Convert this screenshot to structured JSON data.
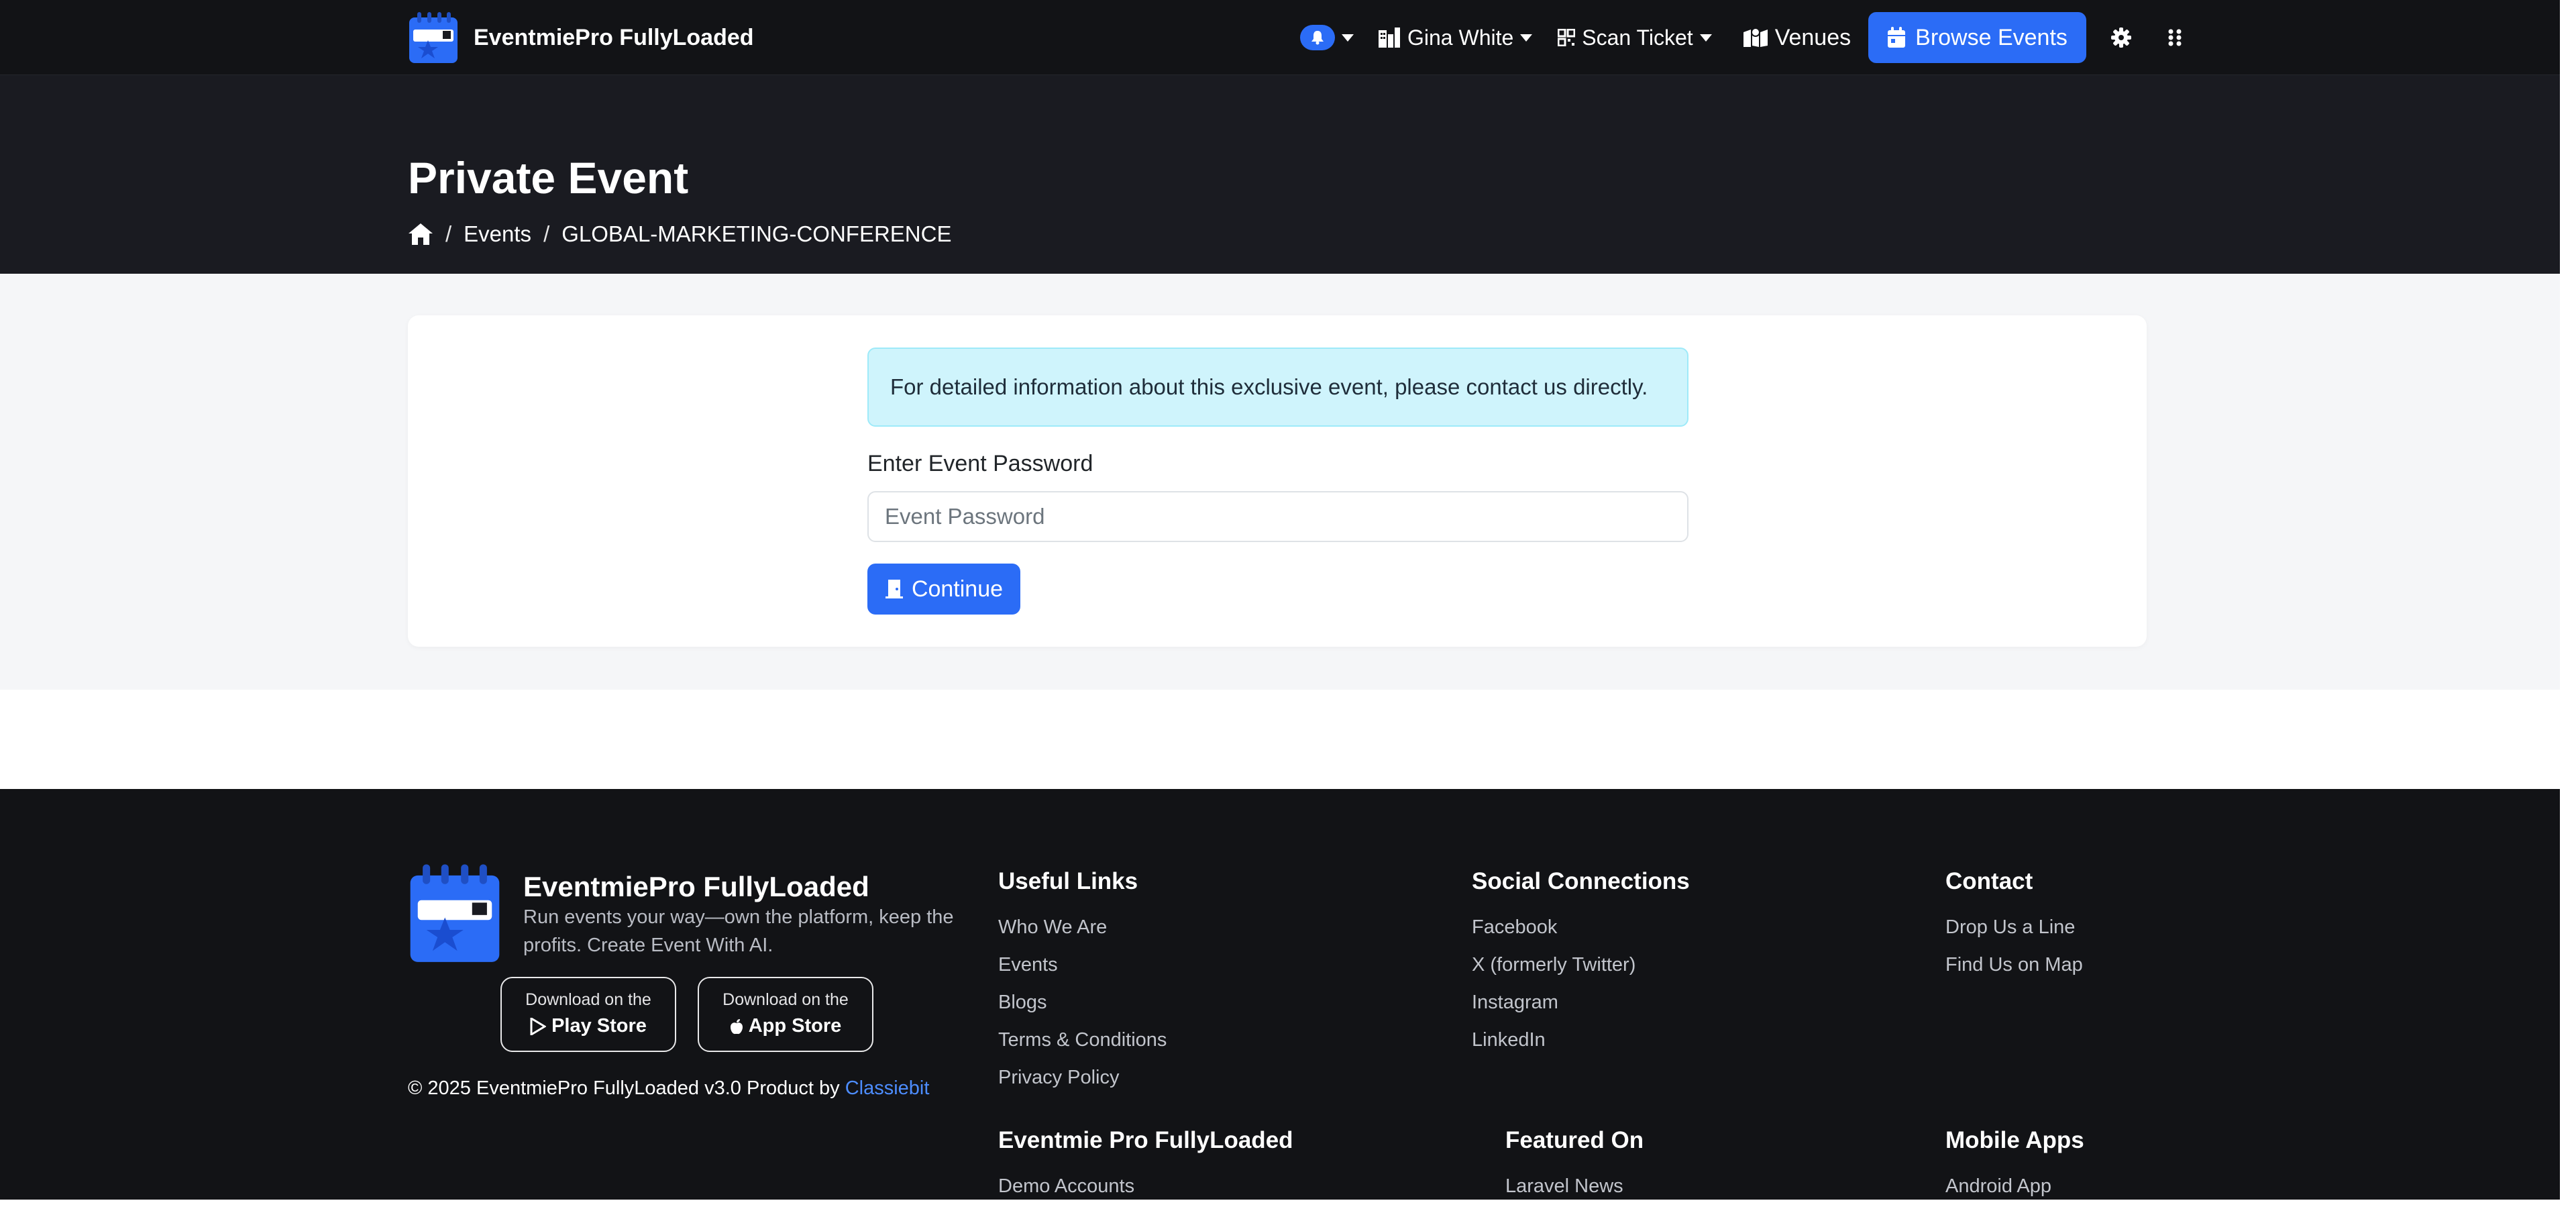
{
  "nav": {
    "brand": "EventmiePro FullyLoaded",
    "user_name": "Gina White",
    "scan_ticket": "Scan Ticket",
    "venues": "Venues",
    "browse_events": "Browse Events",
    "icons": [
      "bell-icon",
      "city-icon",
      "qrcode-icon",
      "map-icon",
      "calendar-icon",
      "gear-icon",
      "grid-icon"
    ]
  },
  "header": {
    "title": "Private Event",
    "breadcrumb": [
      "Events",
      "GLOBAL-MARKETING-CONFERENCE"
    ]
  },
  "main": {
    "alert": "For detailed information about this exclusive event, please contact us directly.",
    "password_label": "Enter Event Password",
    "password_placeholder": "Event Password",
    "password_value": "",
    "continue_label": "Continue"
  },
  "footer": {
    "brand": "EventmiePro FullyLoaded",
    "tagline": "Run events your way—own the platform, keep the profits. Create Event With AI.",
    "play_small": "Download on the",
    "play_big": "Play Store",
    "apple_small": "Download on the",
    "apple_big": "App Store",
    "copyright_prefix": "© 2025 EventmiePro FullyLoaded v3.0 Product by",
    "copyright_link": "Classiebit",
    "useful_links": {
      "title": "Useful Links",
      "items": [
        "Who We Are",
        "Events",
        "Blogs",
        "Terms & Conditions",
        "Privacy Policy"
      ]
    },
    "social": {
      "title": "Social Connections",
      "items": [
        "Facebook",
        "X (formerly Twitter)",
        "Instagram",
        "LinkedIn"
      ]
    },
    "contact": {
      "title": "Contact",
      "items": [
        "Drop Us a Line",
        "Find Us on Map"
      ]
    },
    "eventmie": {
      "title": "Eventmie Pro FullyLoaded",
      "items": [
        "Demo Accounts"
      ]
    },
    "featured": {
      "title": "Featured On",
      "items": [
        "Laravel News"
      ]
    },
    "mobile_apps": {
      "title": "Mobile Apps",
      "items": [
        "Android App"
      ]
    }
  }
}
